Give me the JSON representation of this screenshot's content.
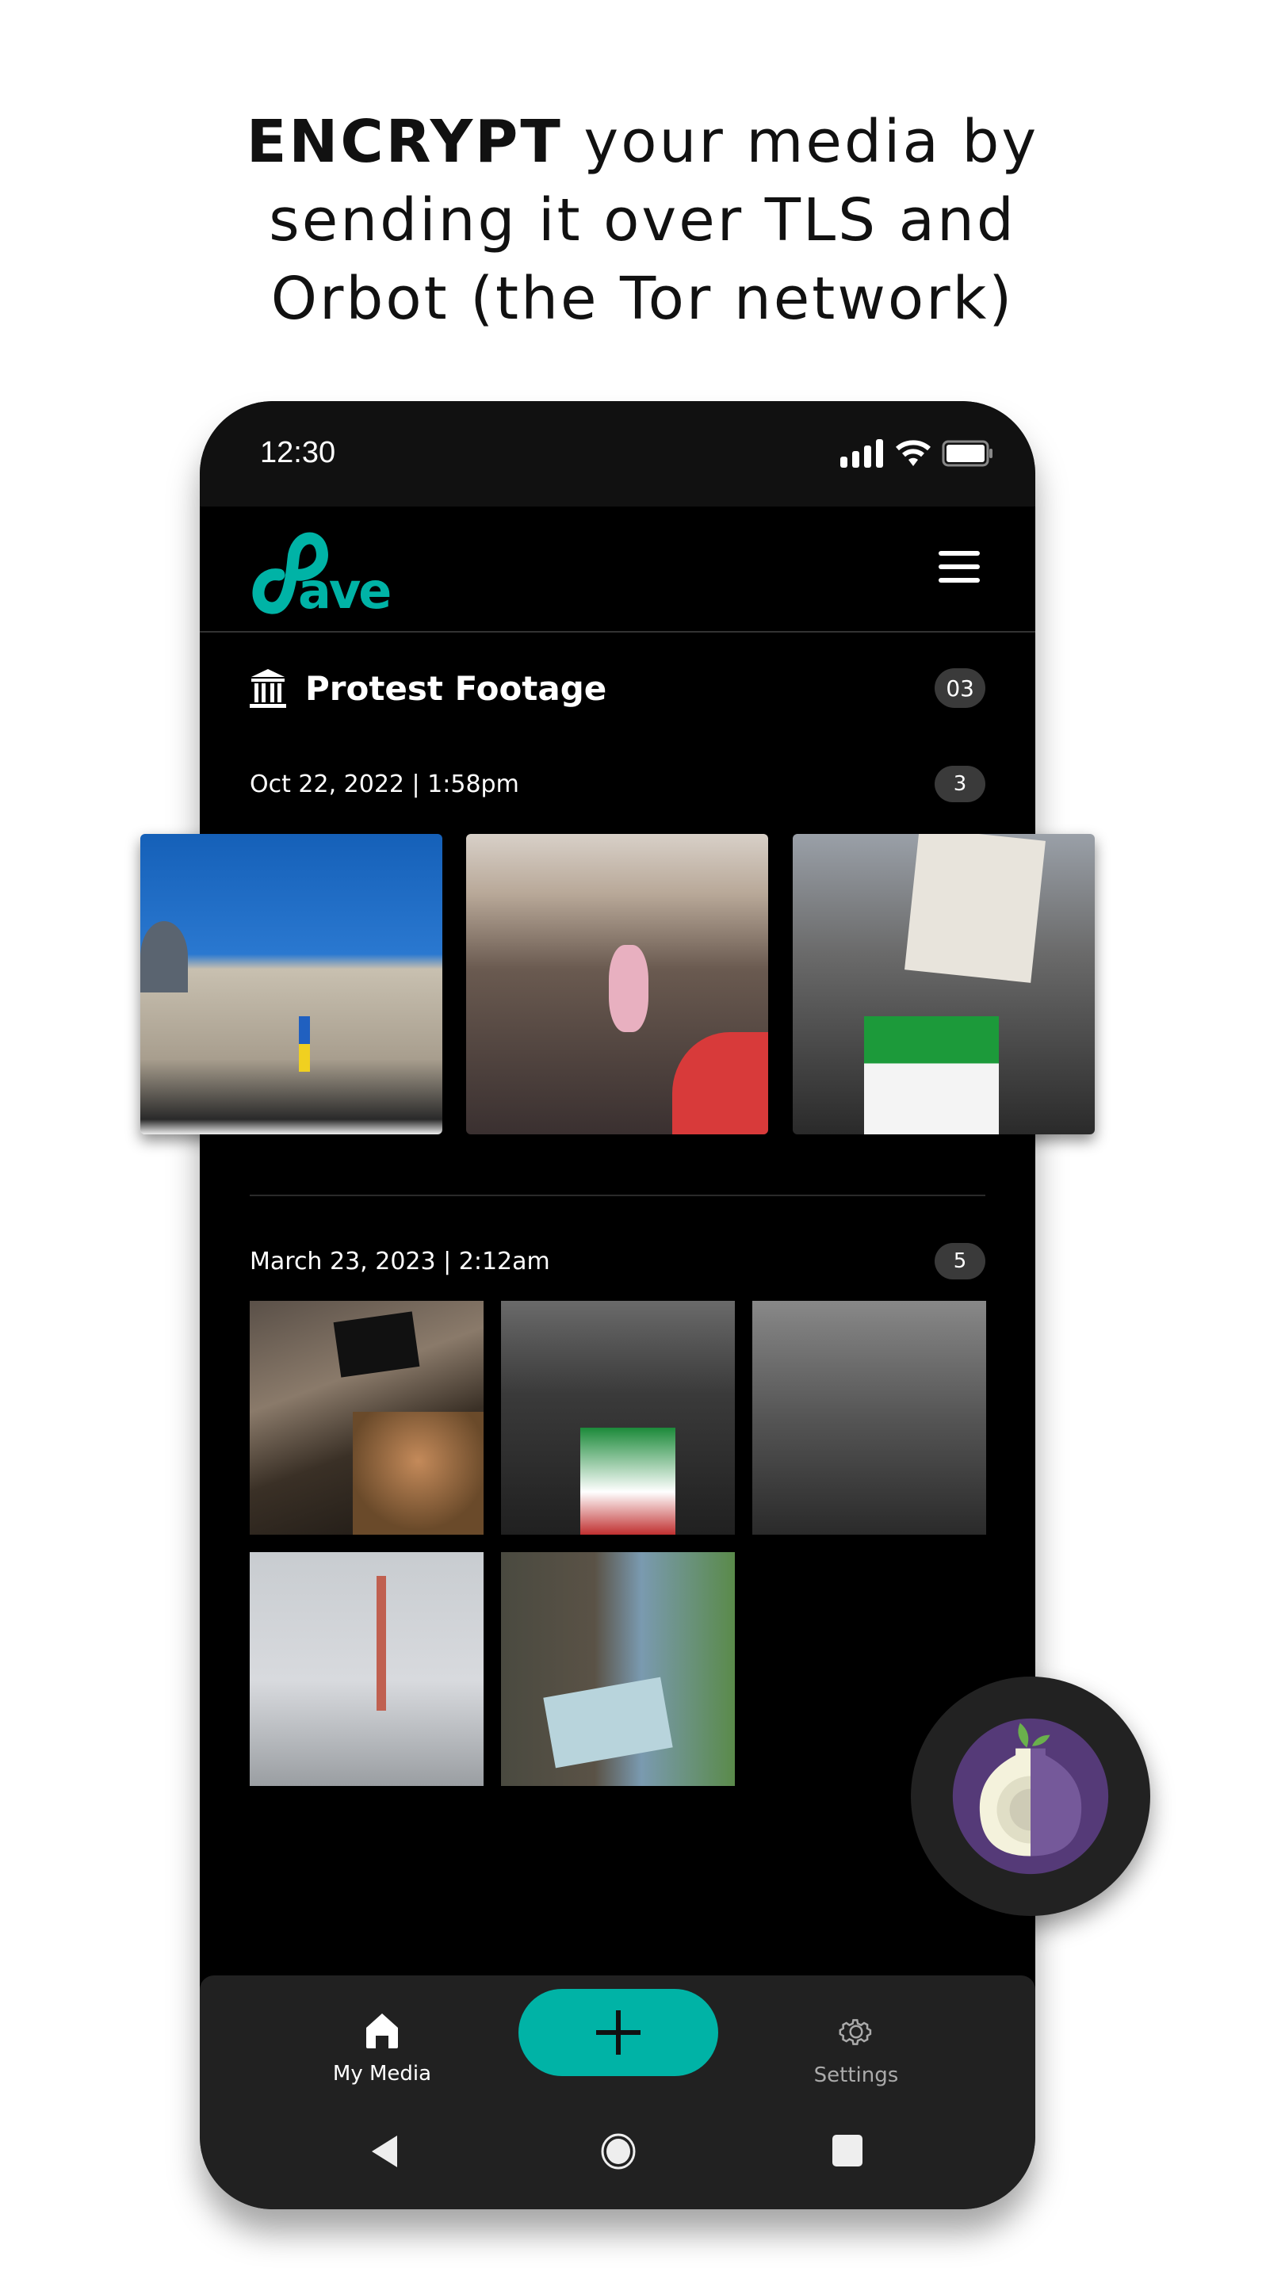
{
  "headline": {
    "bold": "ENCRYPT",
    "line1_rest": " your media by",
    "line2": "sending it over TLS and",
    "line3": "Orbot (the Tor network)"
  },
  "status_bar": {
    "time": "12:30",
    "icons": [
      "signal-icon",
      "wifi-icon",
      "battery-icon"
    ]
  },
  "app": {
    "logo_text": "Save",
    "accent": "#00b3a6"
  },
  "folder": {
    "title": "Protest Footage",
    "icon": "museum-icon",
    "count": "03"
  },
  "groups": [
    {
      "date": "Oct 22, 2022 | 1:58pm",
      "count": "3"
    },
    {
      "date": "March 23, 2023 | 2:12am",
      "count": "5"
    }
  ],
  "bottom_nav": {
    "my_media": "My Media",
    "settings": "Settings",
    "add_icon": "plus-icon"
  },
  "system_nav": [
    "back-icon",
    "home-icon",
    "recents-icon"
  ],
  "badge": {
    "name": "Orbot",
    "icon": "tor-onion-icon"
  }
}
